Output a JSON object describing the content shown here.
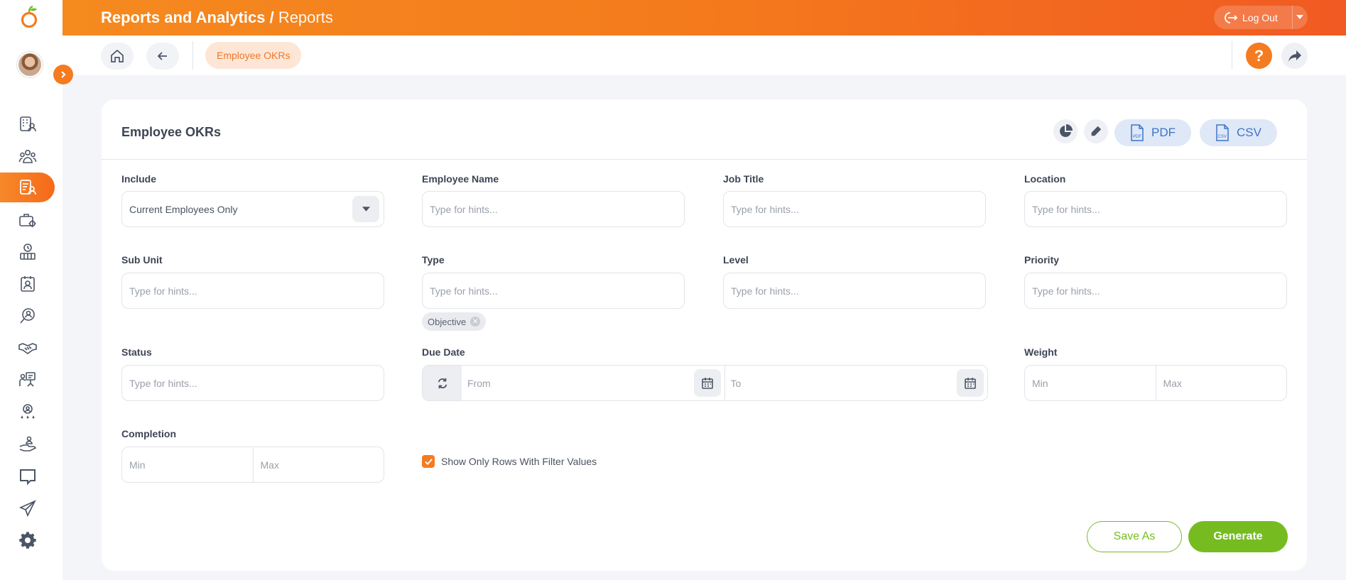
{
  "header": {
    "module": "Reports and Analytics",
    "separator": " / ",
    "page": "Reports",
    "logout_label": "Log Out"
  },
  "breadcrumb": {
    "current": "Employee OKRs"
  },
  "sidebar": {
    "items": [
      {
        "icon": "employee-directory-icon",
        "active": false
      },
      {
        "icon": "people-icon",
        "active": false
      },
      {
        "icon": "reports-icon",
        "active": true
      },
      {
        "icon": "briefcase-settings-icon",
        "active": false
      },
      {
        "icon": "time-attendance-icon",
        "active": false
      },
      {
        "icon": "id-badge-icon",
        "active": false
      },
      {
        "icon": "recruitment-search-icon",
        "active": false
      },
      {
        "icon": "handshake-icon",
        "active": false
      },
      {
        "icon": "training-presentation-icon",
        "active": false
      },
      {
        "icon": "performance-rating-icon",
        "active": false
      },
      {
        "icon": "benefits-hand-icon",
        "active": false
      },
      {
        "icon": "message-icon",
        "active": false
      },
      {
        "icon": "travel-plane-icon",
        "active": false
      },
      {
        "icon": "settings-gear-icon",
        "active": false
      }
    ]
  },
  "card": {
    "title": "Employee OKRs",
    "pdf_label": "PDF",
    "csv_label": "CSV"
  },
  "filters": {
    "include": {
      "label": "Include",
      "value": "Current Employees Only"
    },
    "employee_name": {
      "label": "Employee Name",
      "placeholder": "Type for hints..."
    },
    "job_title": {
      "label": "Job Title",
      "placeholder": "Type for hints..."
    },
    "location": {
      "label": "Location",
      "placeholder": "Type for hints..."
    },
    "sub_unit": {
      "label": "Sub Unit",
      "placeholder": "Type for hints..."
    },
    "type": {
      "label": "Type",
      "placeholder": "Type for hints...",
      "chips": [
        "Objective"
      ]
    },
    "level": {
      "label": "Level",
      "placeholder": "Type for hints..."
    },
    "priority": {
      "label": "Priority",
      "placeholder": "Type for hints..."
    },
    "status": {
      "label": "Status",
      "placeholder": "Type for hints..."
    },
    "due_date": {
      "label": "Due Date",
      "from_placeholder": "From",
      "to_placeholder": "To"
    },
    "weight": {
      "label": "Weight",
      "min_placeholder": "Min",
      "max_placeholder": "Max"
    },
    "completion": {
      "label": "Completion",
      "min_placeholder": "Min",
      "max_placeholder": "Max"
    },
    "show_only_rows": {
      "label": "Show Only Rows With Filter Values",
      "checked": true
    }
  },
  "actions": {
    "save_as": "Save As",
    "generate": "Generate"
  },
  "colors": {
    "accent": "#f57b20",
    "success": "#76bc21",
    "export": "#3d74c9"
  }
}
